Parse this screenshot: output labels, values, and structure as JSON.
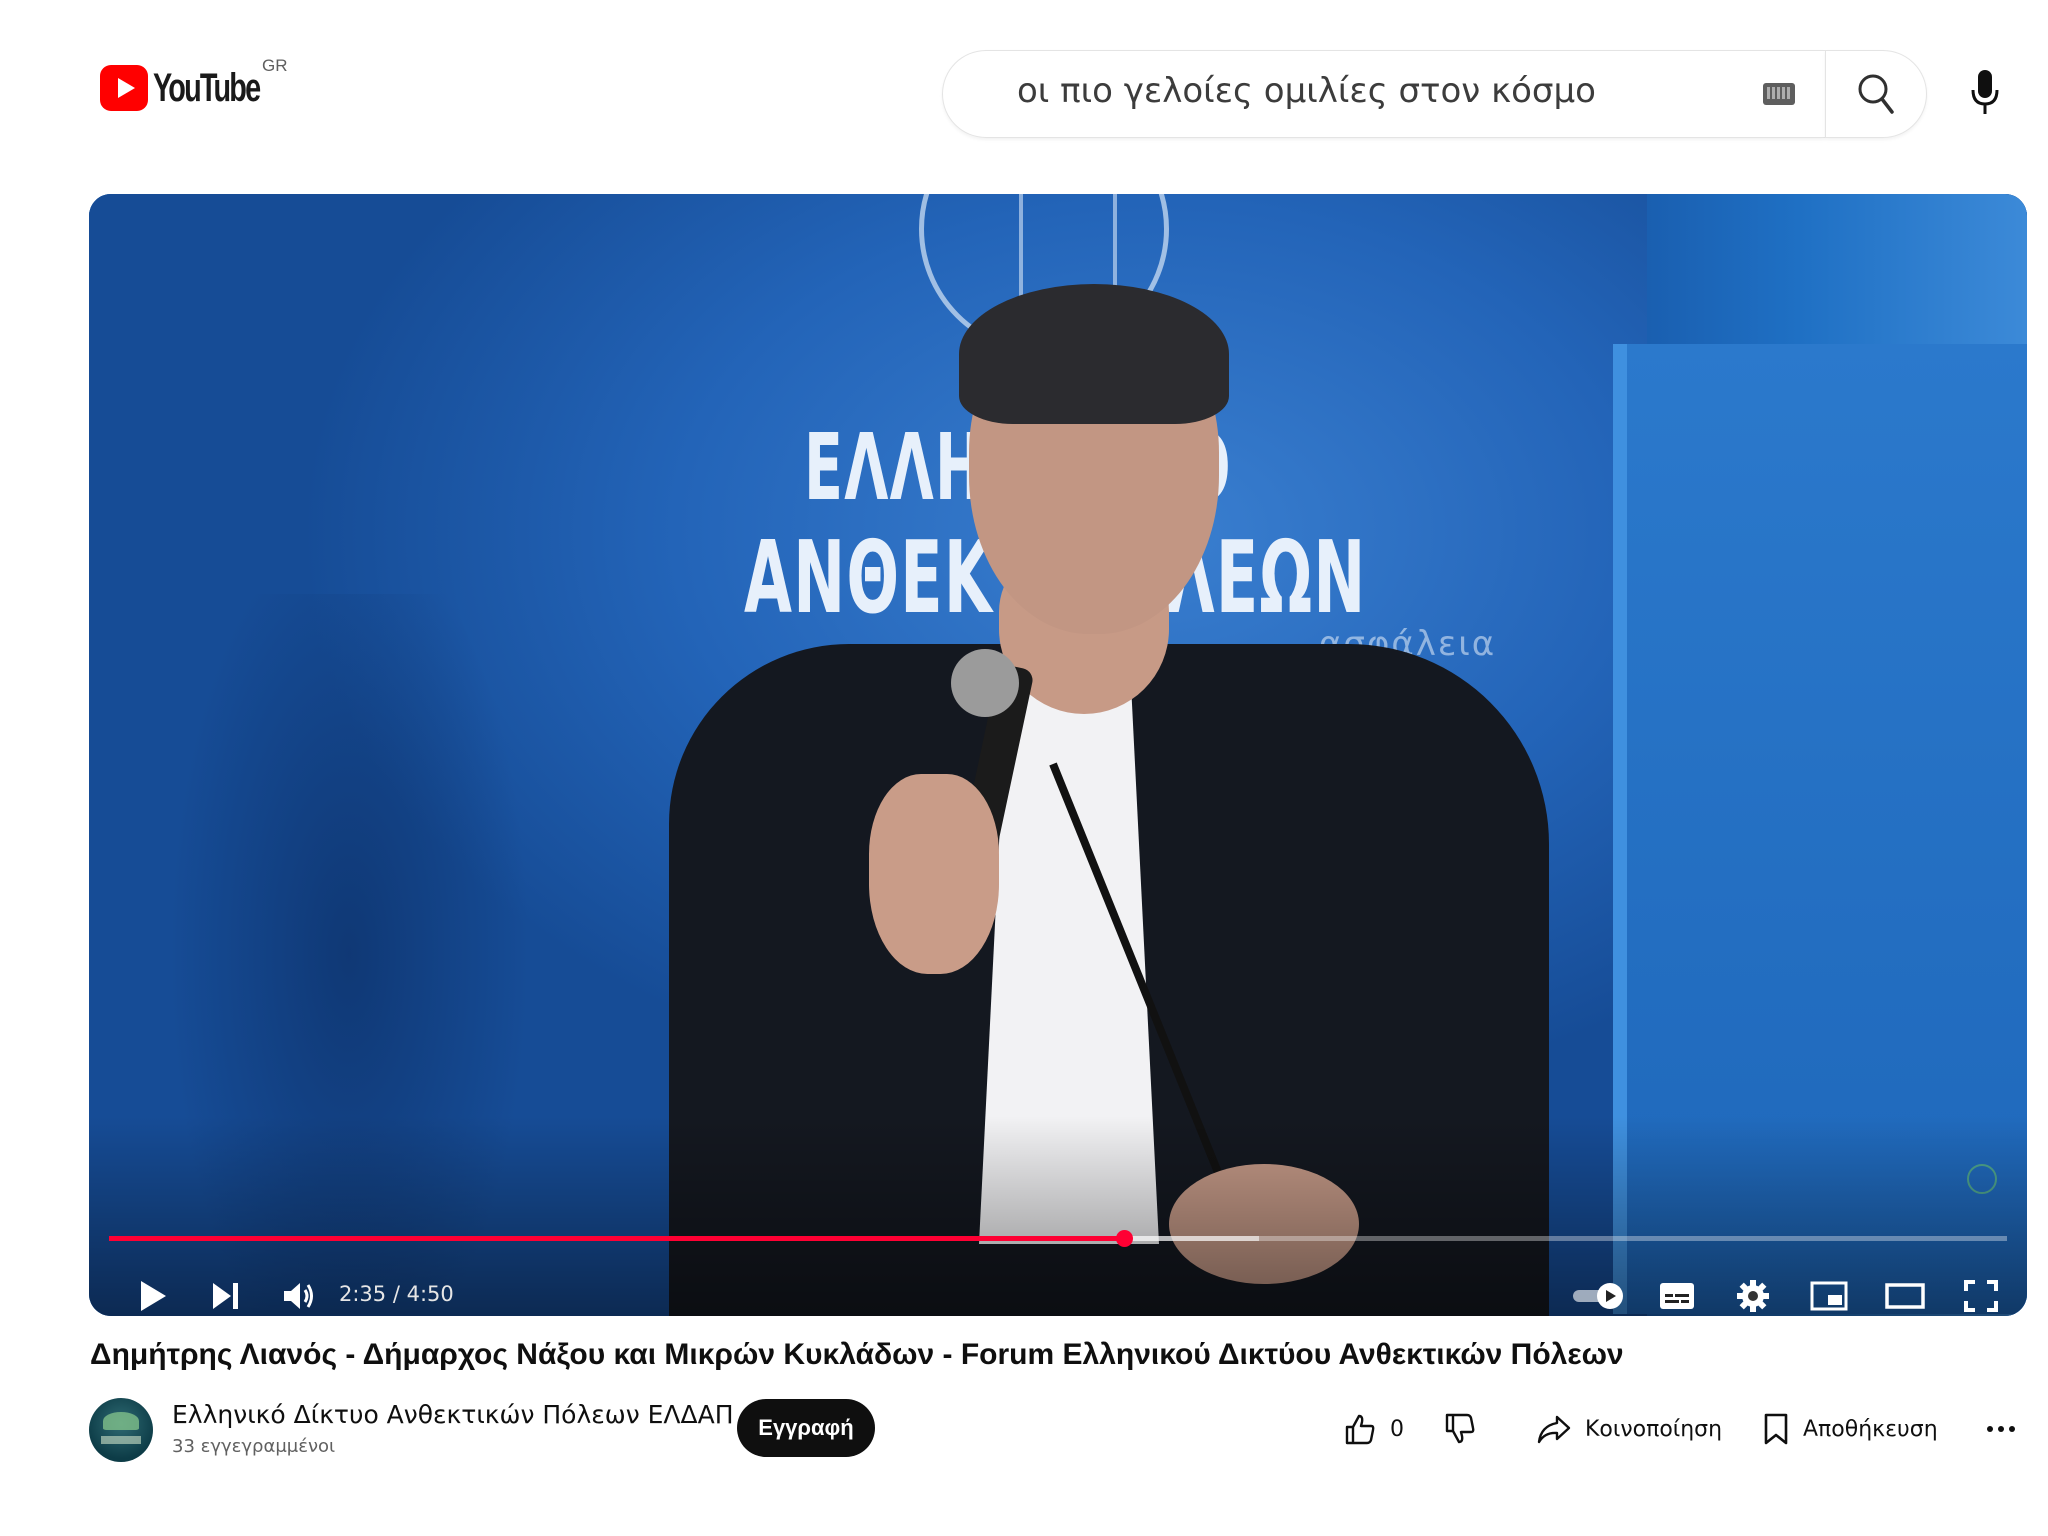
{
  "masthead": {
    "logo_text": "YouTube",
    "country_code": "GR",
    "search": {
      "value": "οι πιο γελοίες ομιλίες στον κόσμο"
    },
    "icons": {
      "keyboard": "keyboard-icon",
      "search": "search-icon",
      "mic": "microphone-icon"
    }
  },
  "player": {
    "stage_text": {
      "line1": "ΕΛΛΗΝ    ΚΤΥΟ",
      "line2": "ΑΝΘΕΚΤ     ΠΟΛΕΩΝ",
      "line3": "ασφάλεια"
    },
    "time": {
      "current": "2:35",
      "separator": " / ",
      "duration": "4:50"
    },
    "progress": {
      "played_fraction": 0.535,
      "buffered_fraction": 0.606
    },
    "accent_color": "#ff0033",
    "controls": [
      "play-icon",
      "next-icon",
      "volume-icon",
      "autoplay-toggle-icon",
      "subtitles-icon",
      "settings-icon",
      "miniplayer-icon",
      "theater-mode-icon",
      "fullscreen-icon"
    ]
  },
  "video": {
    "title": "Δημήτρης Λιανός - Δήμαρχος Νάξου και Μικρών Κυκλάδων - Forum Ελληνικού Δικτύου Ανθεκτικών Πόλεων"
  },
  "channel": {
    "name": "Ελληνικό Δίκτυο Ανθεκτικών Πόλεων ΕΛΔΑΠ",
    "subscribers": "33 εγγεγραμμένοι",
    "subscribe_label": "Εγγραφή"
  },
  "actions": {
    "like_count": "0",
    "share_label": "Κοινοποίηση",
    "save_label": "Αποθήκευση"
  }
}
